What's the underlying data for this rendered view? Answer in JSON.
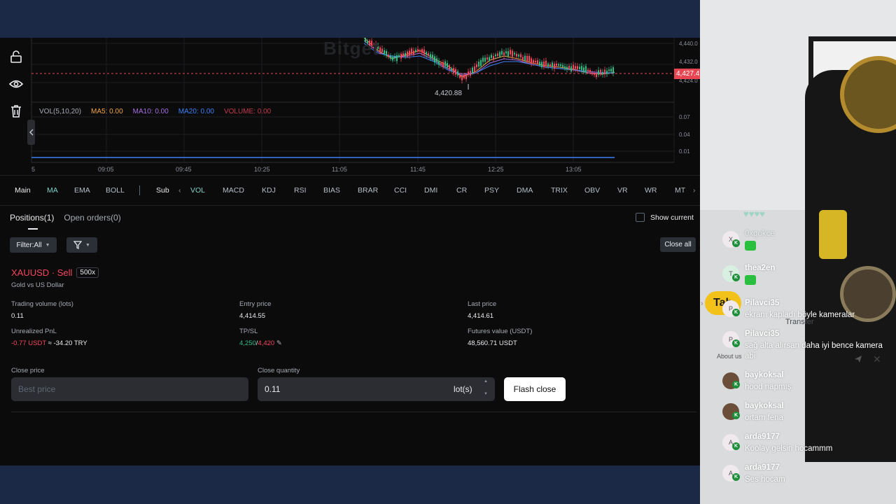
{
  "colors": {
    "up": "#2ebd85",
    "down": "#f6465d",
    "ma5": "#f0a54a",
    "ma10": "#a66ee0",
    "ma20": "#3d7ff5",
    "volume": "#c23b4b",
    "accent_teal": "#7fd1c8"
  },
  "chart": {
    "watermark": "Bitget",
    "current_price": "4,427.4",
    "low_label": "4,420.88",
    "price_axis": [
      "4,440.0",
      "4,432.0",
      "4,424.0"
    ],
    "vol_axis": [
      "0.07",
      "0.04",
      "0.01"
    ],
    "x_axis": [
      "5",
      "09:05",
      "09:45",
      "10:25",
      "11:05",
      "11:45",
      "12:25",
      "13:05"
    ],
    "legend": {
      "vol": "VOL(5,10,20)",
      "ma5": "MA5: 0.00",
      "ma10": "MA10: 0.00",
      "ma20": "MA20: 0.00",
      "volume": "VOLUME: 0.00"
    }
  },
  "indicators": {
    "main_label": "Main",
    "main": [
      "MA",
      "EMA",
      "BOLL"
    ],
    "active_main": "MA",
    "sub_label": "Sub",
    "sub": [
      "VOL",
      "MACD",
      "KDJ",
      "RSI",
      "BIAS",
      "BRAR",
      "CCI",
      "DMI",
      "CR",
      "PSY",
      "DMA",
      "TRIX",
      "OBV",
      "VR",
      "WR",
      "MT"
    ],
    "active_sub": "VOL"
  },
  "tabs": {
    "positions": "Positions(1)",
    "open_orders": "Open orders(0)",
    "show_current": "Show current"
  },
  "filters": {
    "filter_label": "Filter:All",
    "close_all": "Close all"
  },
  "position": {
    "symbol": "XAUUSD · Sell",
    "leverage": "500x",
    "name": "Gold vs US Dollar",
    "trading_volume_label": "Trading volume (lots)",
    "trading_volume": "0.11",
    "entry_price_label": "Entry price",
    "entry_price": "4,414.55",
    "last_price_label": "Last price",
    "last_price": "4,414.61",
    "pnl_label": "Unrealized PnL",
    "pnl": "-0.77 USDT",
    "pnl_try": "≈ -34.20 TRY",
    "tpsl_label": "TP/SL",
    "tp": "4,250",
    "sl": "4,420",
    "futures_value_label": "Futures value (USDT)",
    "futures_value": "48,560.71 USDT",
    "close_price_label": "Close price",
    "close_price_placeholder": "Best price",
    "close_qty_label": "Close quantity",
    "close_qty": "0.11",
    "qty_unit": "lot(s)",
    "flash_close": "Flash close"
  },
  "stream": {
    "pill_text": "Tah",
    "transfer": "Transfer",
    "about": "About us",
    "hearts": "♥♥♥♥",
    "messages": [
      {
        "initial": "X",
        "user": "0xgokce",
        "text": "",
        "emote": true
      },
      {
        "initial": "T",
        "user": "thea2en",
        "text": "",
        "emote": true
      },
      {
        "initial": "P",
        "user": "Pilavci35",
        "text": "ekranı kapladı böyle kameralar",
        "emote": false
      },
      {
        "initial": "P",
        "user": "Pilavci35",
        "text": "sağ alta alırsan daha iyi bence kamera abi",
        "emote": false
      },
      {
        "initial": "",
        "user": "baykoksal",
        "text": "hood napmış",
        "emote": false
      },
      {
        "initial": "",
        "user": "baykoksal",
        "text": "ortam fena",
        "emote": false
      },
      {
        "initial": "A",
        "user": "arda9177",
        "text": "Koolay gelsin hocammm",
        "emote": false
      },
      {
        "initial": "A",
        "user": "arda9177",
        "text": "Ses hocam",
        "emote": false
      }
    ]
  }
}
